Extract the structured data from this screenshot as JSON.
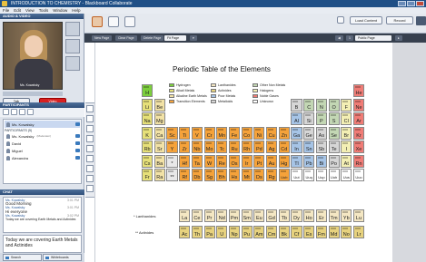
{
  "window": {
    "title": "INTRODUCTION TO CHEMISTRY - Blackboard Collaborate"
  },
  "menu": {
    "items": [
      "File",
      "Edit",
      "View",
      "Tools",
      "Window",
      "Help"
    ]
  },
  "left": {
    "audio_video_title": "AUDIO & VIDEO",
    "video_name": "Ms. Kowalsky",
    "talk_label": "Talk",
    "video_label": "Video",
    "participants_title": "PARTICIPANTS",
    "participants": [
      {
        "group": "",
        "name": "Ms. Kowalsky",
        "sub": ""
      },
      {
        "group": "PARTICIPANTS (5)",
        "name": "Ms. Kowalsky",
        "sub": "(Moderator)"
      },
      {
        "group": "",
        "name": "David",
        "sub": ""
      },
      {
        "group": "",
        "name": "Miguel",
        "sub": ""
      },
      {
        "group": "",
        "name": "Alexandra",
        "sub": ""
      }
    ],
    "chat_title": "CHAT",
    "chat": [
      {
        "who": "Ms. Kowalsky",
        "time": "3:01 PM",
        "text": "Good Morning"
      },
      {
        "who": "Ms. Kowalsky",
        "time": "3:01 PM",
        "text": "Hi everyone"
      },
      {
        "who": "Ms. Kowalsky",
        "time": "3:02 PM",
        "text": "Today we are covering Earth Metals and Actinides"
      }
    ],
    "chat_input": "Today we are covering Earth Metals and Actinides",
    "tabs": [
      "Search",
      "Whiteboards"
    ]
  },
  "toolbar": {
    "load_content": "Load Content",
    "record": "Record",
    "new_page": "New Page",
    "clear_page": "Clear Page",
    "delete_page": "Delete Page",
    "zoom": "Fit Page",
    "page_select": "Public Page",
    "page_num": "1"
  },
  "periodic": {
    "title": "Periodic Table of the Elements",
    "legend": [
      {
        "label": "Hydrogen",
        "color": "#7ccf3c"
      },
      {
        "label": "Alkali Metals",
        "color": "#e6e079"
      },
      {
        "label": "Alkaline Earth Metals",
        "color": "#f2e2a6"
      },
      {
        "label": "Transition Elements",
        "color": "#f5a23a"
      },
      {
        "label": "Lanthanides",
        "color": "#f4e7c3"
      },
      {
        "label": "Actinides",
        "color": "#e7d27e"
      },
      {
        "label": "Poor Metals",
        "color": "#a6c4e6"
      },
      {
        "label": "Metalloids",
        "color": "#d6d6d6"
      },
      {
        "label": "Other Non Metals",
        "color": "#c3d7b4"
      },
      {
        "label": "Halogens",
        "color": "#f3efb4"
      },
      {
        "label": "Noble Gases",
        "color": "#f07c76"
      },
      {
        "label": "Unknown",
        "color": "#ffffff"
      }
    ],
    "lanthanides_label": "* Lanthanides",
    "actinides_label": "** Actinides",
    "elements": [
      {
        "s": "H",
        "r": 0,
        "c": 0,
        "t": "h"
      },
      {
        "s": "He",
        "r": 0,
        "c": 17,
        "t": "n"
      },
      {
        "s": "Li",
        "r": 1,
        "c": 0,
        "t": "a"
      },
      {
        "s": "Be",
        "r": 1,
        "c": 1,
        "t": "e"
      },
      {
        "s": "B",
        "r": 1,
        "c": 12,
        "t": "m"
      },
      {
        "s": "C",
        "r": 1,
        "c": 13,
        "t": "o"
      },
      {
        "s": "N",
        "r": 1,
        "c": 14,
        "t": "o"
      },
      {
        "s": "O",
        "r": 1,
        "c": 15,
        "t": "o"
      },
      {
        "s": "F",
        "r": 1,
        "c": 16,
        "t": "g"
      },
      {
        "s": "Ne",
        "r": 1,
        "c": 17,
        "t": "n"
      },
      {
        "s": "Na",
        "r": 2,
        "c": 0,
        "t": "a"
      },
      {
        "s": "Mg",
        "r": 2,
        "c": 1,
        "t": "e"
      },
      {
        "s": "Al",
        "r": 2,
        "c": 12,
        "t": "p"
      },
      {
        "s": "Si",
        "r": 2,
        "c": 13,
        "t": "m"
      },
      {
        "s": "P",
        "r": 2,
        "c": 14,
        "t": "o"
      },
      {
        "s": "S",
        "r": 2,
        "c": 15,
        "t": "o"
      },
      {
        "s": "Cl",
        "r": 2,
        "c": 16,
        "t": "g"
      },
      {
        "s": "Ar",
        "r": 2,
        "c": 17,
        "t": "n"
      },
      {
        "s": "K",
        "r": 3,
        "c": 0,
        "t": "a"
      },
      {
        "s": "Ca",
        "r": 3,
        "c": 1,
        "t": "e"
      },
      {
        "s": "Sc",
        "r": 3,
        "c": 2,
        "t": "t"
      },
      {
        "s": "Ti",
        "r": 3,
        "c": 3,
        "t": "t"
      },
      {
        "s": "V",
        "r": 3,
        "c": 4,
        "t": "t"
      },
      {
        "s": "Cr",
        "r": 3,
        "c": 5,
        "t": "t"
      },
      {
        "s": "Mn",
        "r": 3,
        "c": 6,
        "t": "t"
      },
      {
        "s": "Fe",
        "r": 3,
        "c": 7,
        "t": "t"
      },
      {
        "s": "Co",
        "r": 3,
        "c": 8,
        "t": "t"
      },
      {
        "s": "Ni",
        "r": 3,
        "c": 9,
        "t": "t"
      },
      {
        "s": "Cu",
        "r": 3,
        "c": 10,
        "t": "t"
      },
      {
        "s": "Zn",
        "r": 3,
        "c": 11,
        "t": "t"
      },
      {
        "s": "Ga",
        "r": 3,
        "c": 12,
        "t": "p"
      },
      {
        "s": "Ge",
        "r": 3,
        "c": 13,
        "t": "m"
      },
      {
        "s": "As",
        "r": 3,
        "c": 14,
        "t": "m"
      },
      {
        "s": "Se",
        "r": 3,
        "c": 15,
        "t": "o"
      },
      {
        "s": "Br",
        "r": 3,
        "c": 16,
        "t": "g"
      },
      {
        "s": "Kr",
        "r": 3,
        "c": 17,
        "t": "n"
      },
      {
        "s": "Rb",
        "r": 4,
        "c": 0,
        "t": "a"
      },
      {
        "s": "Sr",
        "r": 4,
        "c": 1,
        "t": "e"
      },
      {
        "s": "Y",
        "r": 4,
        "c": 2,
        "t": "t"
      },
      {
        "s": "Zr",
        "r": 4,
        "c": 3,
        "t": "t"
      },
      {
        "s": "Nb",
        "r": 4,
        "c": 4,
        "t": "t"
      },
      {
        "s": "Mo",
        "r": 4,
        "c": 5,
        "t": "t"
      },
      {
        "s": "Tc",
        "r": 4,
        "c": 6,
        "t": "t"
      },
      {
        "s": "Ru",
        "r": 4,
        "c": 7,
        "t": "t"
      },
      {
        "s": "Rh",
        "r": 4,
        "c": 8,
        "t": "t"
      },
      {
        "s": "Pd",
        "r": 4,
        "c": 9,
        "t": "t"
      },
      {
        "s": "Ag",
        "r": 4,
        "c": 10,
        "t": "t"
      },
      {
        "s": "Cd",
        "r": 4,
        "c": 11,
        "t": "t"
      },
      {
        "s": "In",
        "r": 4,
        "c": 12,
        "t": "p"
      },
      {
        "s": "Sn",
        "r": 4,
        "c": 13,
        "t": "p"
      },
      {
        "s": "Sb",
        "r": 4,
        "c": 14,
        "t": "m"
      },
      {
        "s": "Te",
        "r": 4,
        "c": 15,
        "t": "m"
      },
      {
        "s": "I",
        "r": 4,
        "c": 16,
        "t": "g"
      },
      {
        "s": "Xe",
        "r": 4,
        "c": 17,
        "t": "n"
      },
      {
        "s": "Cs",
        "r": 5,
        "c": 0,
        "t": "a"
      },
      {
        "s": "Ba",
        "r": 5,
        "c": 1,
        "t": "e"
      },
      {
        "s": "*",
        "r": 5,
        "c": 2,
        "t": "x"
      },
      {
        "s": "Hf",
        "r": 5,
        "c": 3,
        "t": "t"
      },
      {
        "s": "Ta",
        "r": 5,
        "c": 4,
        "t": "t"
      },
      {
        "s": "W",
        "r": 5,
        "c": 5,
        "t": "t"
      },
      {
        "s": "Re",
        "r": 5,
        "c": 6,
        "t": "t"
      },
      {
        "s": "Os",
        "r": 5,
        "c": 7,
        "t": "t"
      },
      {
        "s": "Ir",
        "r": 5,
        "c": 8,
        "t": "t"
      },
      {
        "s": "Pt",
        "r": 5,
        "c": 9,
        "t": "t"
      },
      {
        "s": "Au",
        "r": 5,
        "c": 10,
        "t": "t"
      },
      {
        "s": "Hg",
        "r": 5,
        "c": 11,
        "t": "t"
      },
      {
        "s": "Tl",
        "r": 5,
        "c": 12,
        "t": "p"
      },
      {
        "s": "Pb",
        "r": 5,
        "c": 13,
        "t": "p"
      },
      {
        "s": "Bi",
        "r": 5,
        "c": 14,
        "t": "p"
      },
      {
        "s": "Po",
        "r": 5,
        "c": 15,
        "t": "m"
      },
      {
        "s": "At",
        "r": 5,
        "c": 16,
        "t": "g"
      },
      {
        "s": "Rn",
        "r": 5,
        "c": 17,
        "t": "n"
      },
      {
        "s": "Fr",
        "r": 6,
        "c": 0,
        "t": "a"
      },
      {
        "s": "Ra",
        "r": 6,
        "c": 1,
        "t": "e"
      },
      {
        "s": "**",
        "r": 6,
        "c": 2,
        "t": "x"
      },
      {
        "s": "Rf",
        "r": 6,
        "c": 3,
        "t": "t"
      },
      {
        "s": "Db",
        "r": 6,
        "c": 4,
        "t": "t"
      },
      {
        "s": "Sg",
        "r": 6,
        "c": 5,
        "t": "t"
      },
      {
        "s": "Bh",
        "r": 6,
        "c": 6,
        "t": "t"
      },
      {
        "s": "Hs",
        "r": 6,
        "c": 7,
        "t": "t"
      },
      {
        "s": "Mt",
        "r": 6,
        "c": 8,
        "t": "t"
      },
      {
        "s": "Ds",
        "r": 6,
        "c": 9,
        "t": "t"
      },
      {
        "s": "Rg",
        "r": 6,
        "c": 10,
        "t": "t"
      },
      {
        "s": "Uub",
        "r": 6,
        "c": 11,
        "t": "t"
      },
      {
        "s": "Uut",
        "r": 6,
        "c": 12,
        "t": "u"
      },
      {
        "s": "Uuq",
        "r": 6,
        "c": 13,
        "t": "u"
      },
      {
        "s": "Uup",
        "r": 6,
        "c": 14,
        "t": "u"
      },
      {
        "s": "Uuh",
        "r": 6,
        "c": 15,
        "t": "u"
      },
      {
        "s": "Uus",
        "r": 6,
        "c": 16,
        "t": "u"
      },
      {
        "s": "Uuo",
        "r": 6,
        "c": 17,
        "t": "u"
      }
    ],
    "lanthanides": [
      "La",
      "Ce",
      "Pr",
      "Nd",
      "Pm",
      "Sm",
      "Eu",
      "Gd",
      "Tb",
      "Dy",
      "Ho",
      "Er",
      "Tm",
      "Yb",
      "Lu"
    ],
    "actinides": [
      "Ac",
      "Th",
      "Pa",
      "U",
      "Np",
      "Pu",
      "Am",
      "Cm",
      "Bk",
      "Cf",
      "Es",
      "Fm",
      "Md",
      "No",
      "Lr"
    ]
  }
}
